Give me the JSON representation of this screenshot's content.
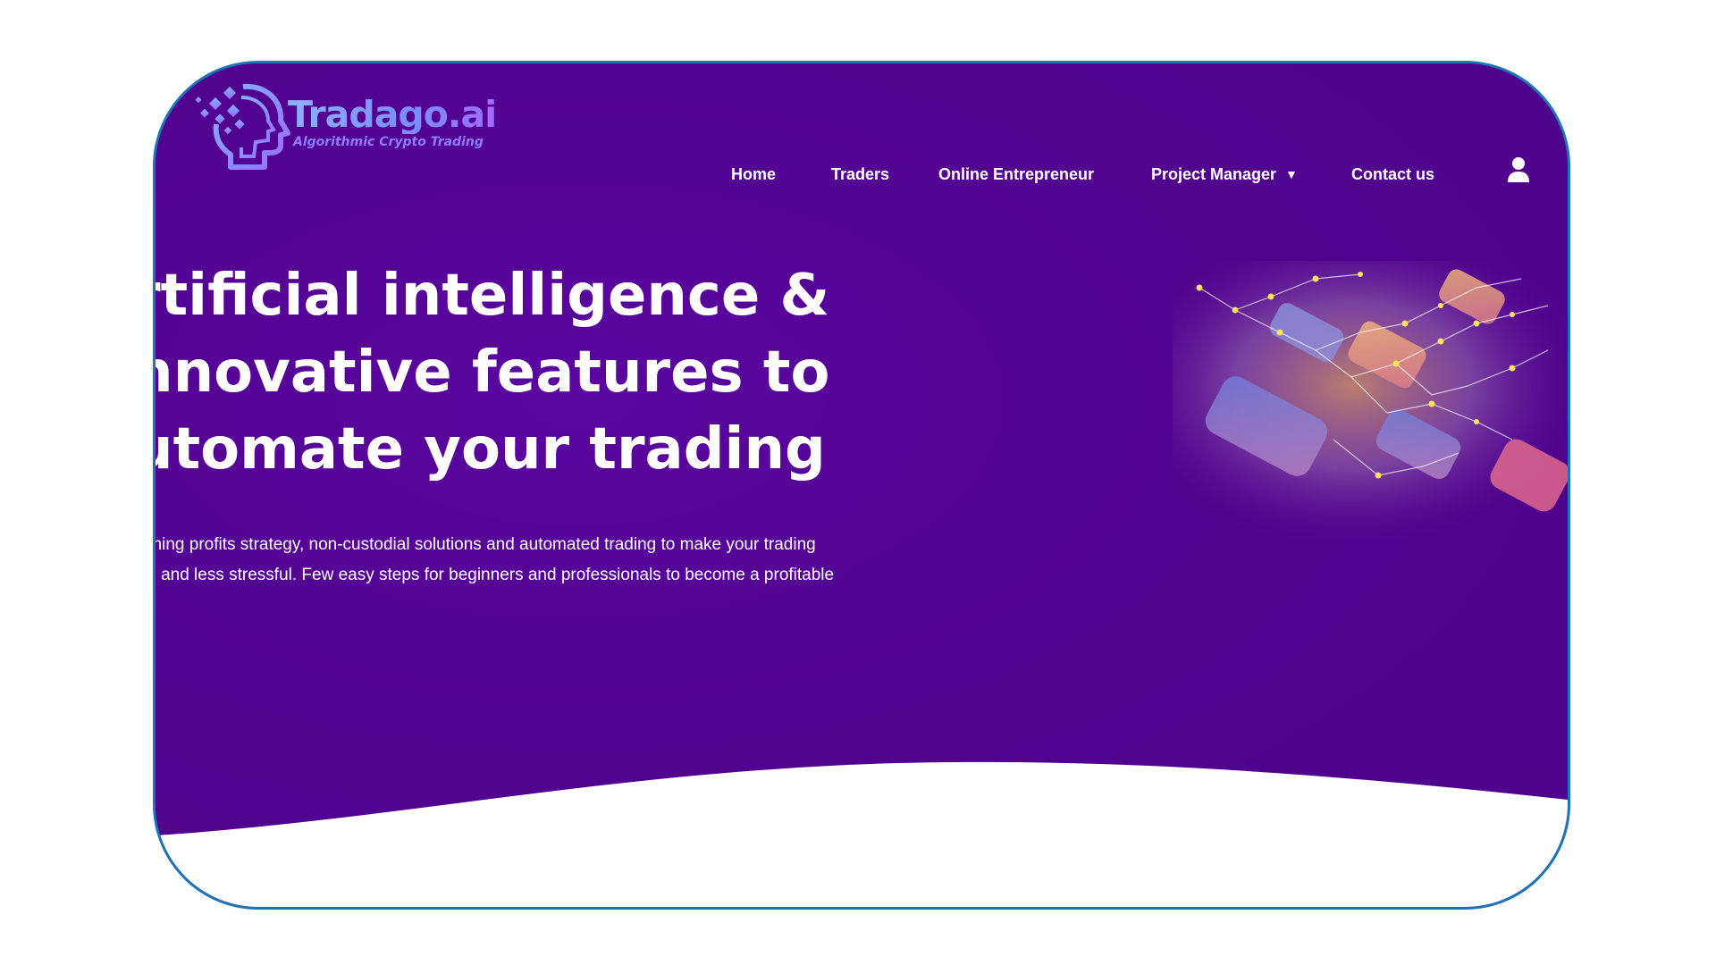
{
  "brand": {
    "name": "Tradago.ai",
    "tagline": "Algorithmic Crypto Trading"
  },
  "nav": {
    "items": [
      {
        "label": "Home"
      },
      {
        "label": "Traders"
      },
      {
        "label": "Online Entrepreneur"
      },
      {
        "label": "Project Manager",
        "has_dropdown": true
      },
      {
        "label": "Contact us"
      }
    ],
    "user_icon": "user-icon",
    "dropdown_icon": "chevron-down-icon"
  },
  "hero": {
    "headline": [
      "rtificial intelligence &",
      "nnovative features to",
      "utomate your trading"
    ],
    "subtext": [
      "nning profits strategy, non-custodial solutions and automated trading to make your trading",
      "le and less stressful. Few easy steps for beginners and professionals to become a profitable"
    ]
  },
  "colors": {
    "hero_background": "#52038f",
    "frame_border": "#1b73b8",
    "logo_blue": "#7fa2ff",
    "text": "#ffffff"
  }
}
